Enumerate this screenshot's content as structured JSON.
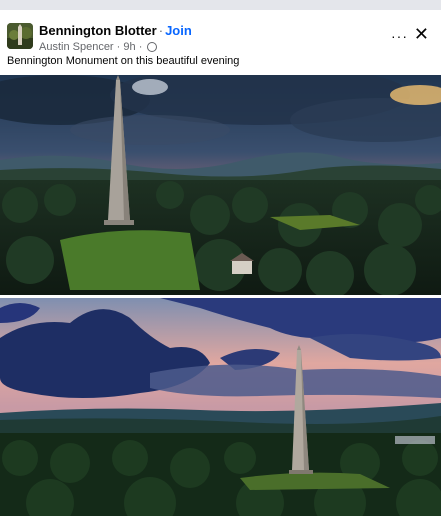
{
  "post": {
    "page_name": "Bennington Blotter",
    "separator": "·",
    "join_label": "Join",
    "author": "Austin Spencer",
    "time": "9h",
    "dot": "·",
    "more_label": "···",
    "close_label": "✕",
    "caption": "Bennington Monument on this beautiful evening"
  },
  "colors": {
    "join": "#0866ff",
    "secondary_text": "#65676b",
    "primary_text": "#050505"
  },
  "icons": [
    "more-options-icon",
    "close-icon",
    "globe-icon"
  ]
}
